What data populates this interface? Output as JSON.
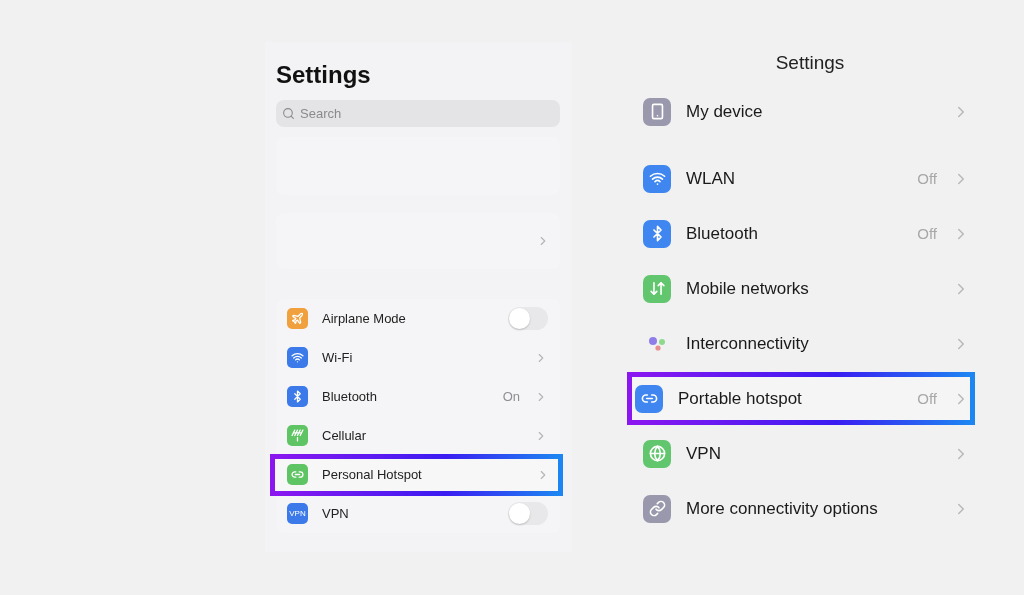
{
  "left_panel": {
    "title": "Settings",
    "search": {
      "placeholder": "Search"
    },
    "items": [
      {
        "kind": "toggle",
        "label": "Airplane Mode",
        "color": "#f0a03c",
        "on": false,
        "highlighted": false
      },
      {
        "kind": "link",
        "label": "Wi-Fi",
        "color": "#3b7ae8",
        "highlighted": false
      },
      {
        "kind": "link",
        "label": "Bluetooth",
        "value": "On",
        "color": "#3b7ae8",
        "highlighted": false
      },
      {
        "kind": "link",
        "label": "Cellular",
        "color": "#5fc463",
        "highlighted": false
      },
      {
        "kind": "link",
        "label": "Personal Hotspot",
        "color": "#5fc463",
        "highlighted": true
      },
      {
        "kind": "toggle",
        "label": "VPN",
        "icon_text": "VPN",
        "color": "#3b7ae8",
        "on": false,
        "highlighted": false
      }
    ]
  },
  "right_panel": {
    "title": "Settings",
    "items": [
      {
        "label": "My device",
        "color": "#9a98ad",
        "highlighted": false
      },
      {
        "label": "WLAN",
        "value": "Off",
        "color": "#3f86f0",
        "highlighted": false
      },
      {
        "label": "Bluetooth",
        "value": "Off",
        "color": "#3f86f0",
        "highlighted": false
      },
      {
        "label": "Mobile networks",
        "color": "#62c66e",
        "highlighted": false
      },
      {
        "label": "Interconnectivity",
        "highlighted": false
      },
      {
        "label": "Portable hotspot",
        "value": "Off",
        "color": "#3f86f0",
        "highlighted": true
      },
      {
        "label": "VPN",
        "color": "#62c66e",
        "highlighted": false
      },
      {
        "label": "More connectivity options",
        "color": "#9a98ad",
        "highlighted": false
      }
    ]
  }
}
